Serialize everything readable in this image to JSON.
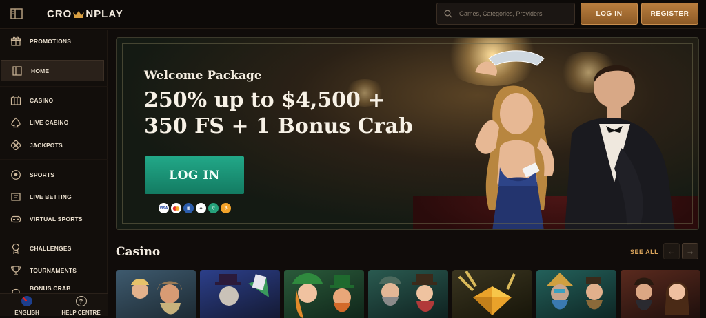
{
  "header": {
    "logo_left": "CRO",
    "logo_right": "NPLAY",
    "search_placeholder": "Games, Categories, Providers",
    "login_label": "LOG IN",
    "register_label": "REGISTER"
  },
  "sidebar": {
    "items": [
      {
        "label": "PROMOTIONS",
        "icon": "gift-icon"
      },
      {
        "label": "HOME",
        "icon": "home-icon"
      },
      {
        "label": "CASINO",
        "icon": "slot-machine-icon"
      },
      {
        "label": "LIVE CASINO",
        "icon": "spade-icon"
      },
      {
        "label": "JACKPOTS",
        "icon": "clover-icon"
      },
      {
        "label": "SPORTS",
        "icon": "soccer-ball-icon"
      },
      {
        "label": "LIVE BETTING",
        "icon": "ticket-icon"
      },
      {
        "label": "VIRTUAL SPORTS",
        "icon": "gamepad-icon"
      },
      {
        "label": "CHALLENGES",
        "icon": "medal-icon"
      },
      {
        "label": "TOURNAMENTS",
        "icon": "trophy-icon"
      },
      {
        "label": "BONUS CRAB",
        "icon": "crab-icon"
      }
    ],
    "language_label": "ENGLISH",
    "help_label": "HELP CENTRE"
  },
  "banner": {
    "subtitle": "Welcome Package",
    "title": "250% up to $4,500 + 350 FS + 1 Bonus Crab",
    "cta_label": "LOG IN",
    "payment_methods": [
      "VISA",
      "MC",
      "ID",
      "ETH",
      "USDT",
      "BTC"
    ]
  },
  "casino_section": {
    "title": "Casino",
    "see_all_label": "SEE ALL"
  },
  "colors": {
    "accent_gold": "#b97e3e",
    "cta_green": "#1b9a7b",
    "background": "#100c0a"
  }
}
